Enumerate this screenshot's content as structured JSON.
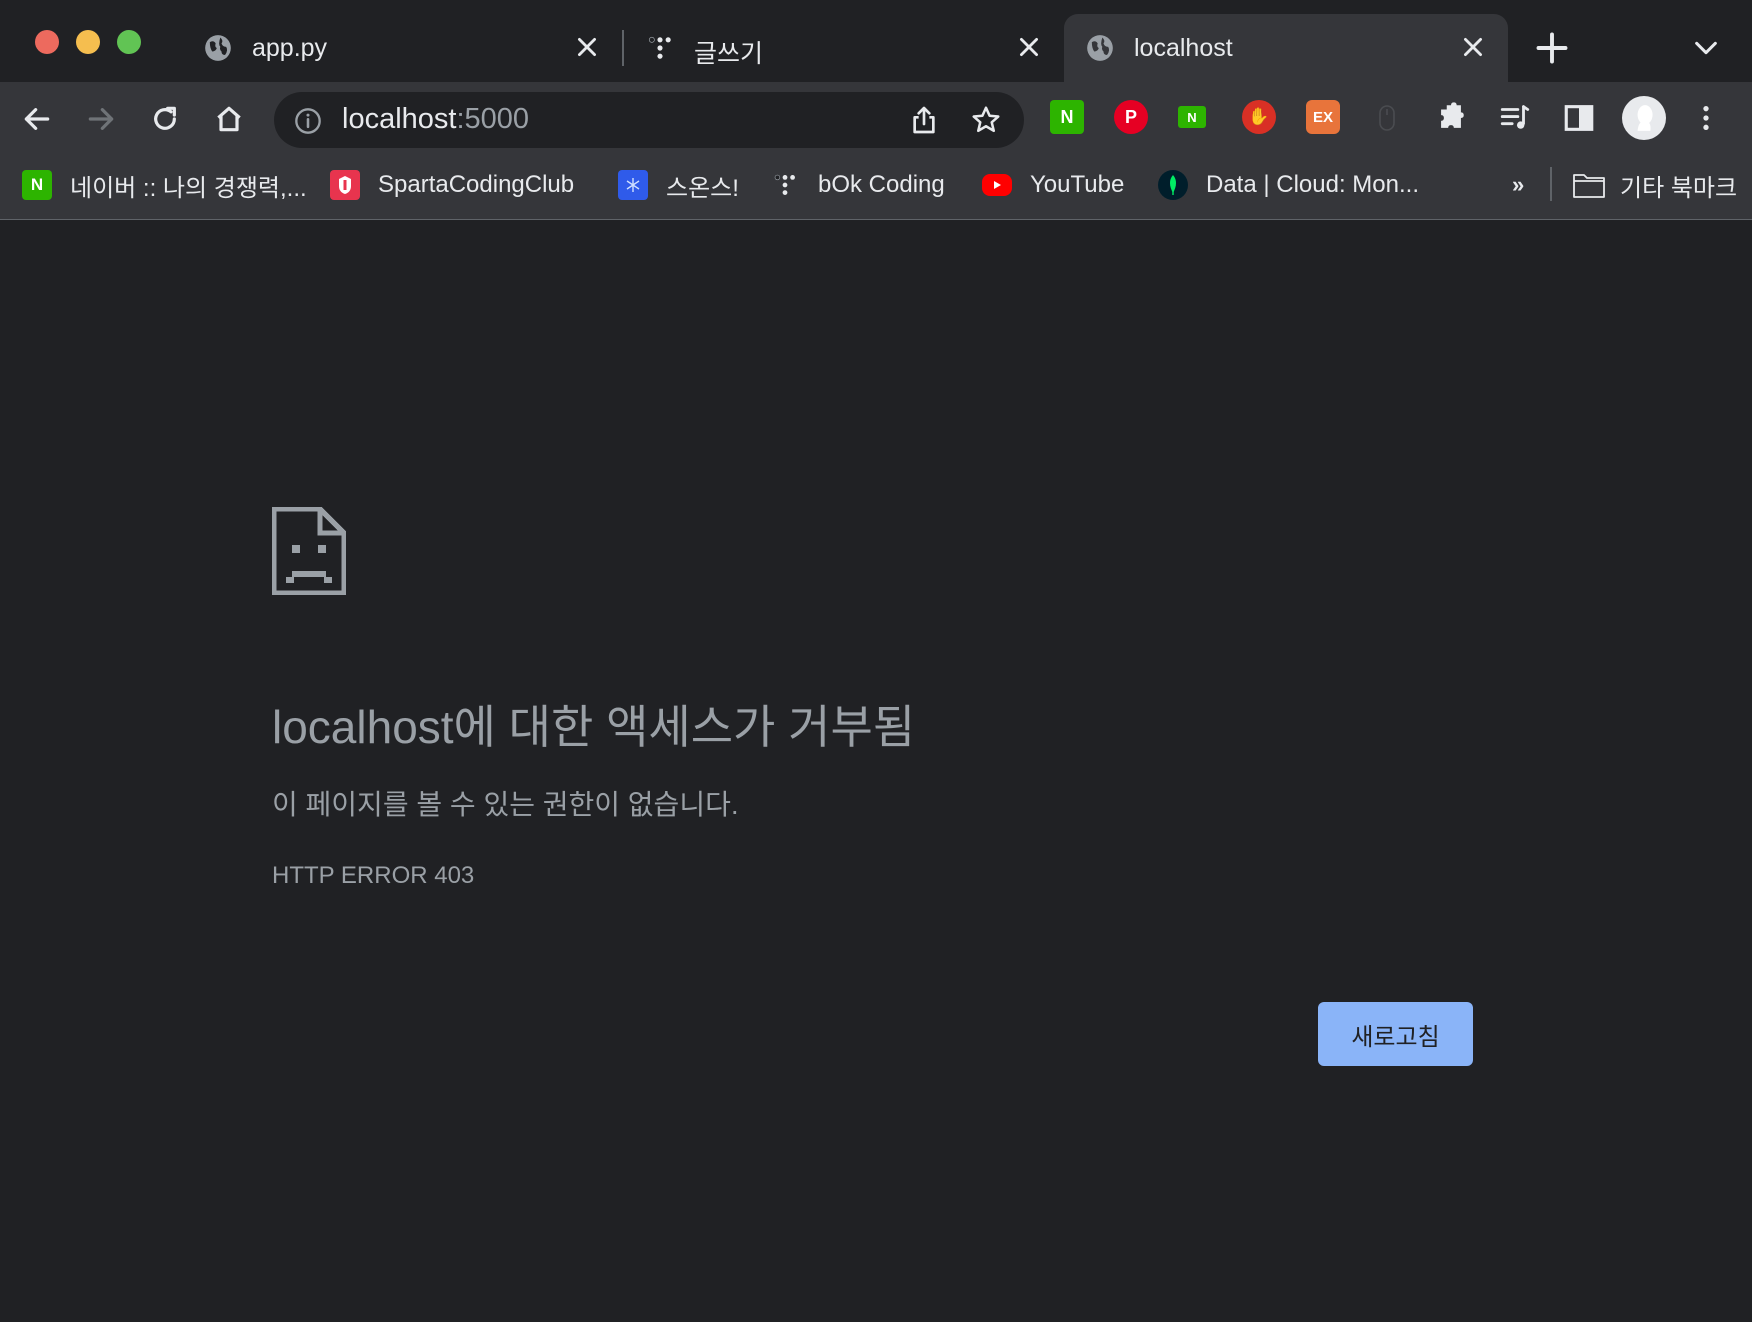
{
  "tabs": [
    {
      "title": "app.py",
      "icon": "globe-icon",
      "active": false
    },
    {
      "title": "글쓰기",
      "icon": "tistory-icon",
      "active": false
    },
    {
      "title": "localhost",
      "icon": "globe-icon",
      "active": true
    }
  ],
  "omnibox": {
    "host": "localhost",
    "port": ":5000"
  },
  "extensions": [
    {
      "name": "naver-extension",
      "label": "N",
      "color": "#2db400"
    },
    {
      "name": "pinterest-extension",
      "label": "P",
      "color": "#e60023"
    },
    {
      "name": "naver-dict-extension",
      "label": "N",
      "color": "#2db400"
    },
    {
      "name": "adblock-extension",
      "label": "✋",
      "color": "#d93025"
    },
    {
      "name": "ex-extension",
      "label": "EX",
      "color": "#e8743b"
    }
  ],
  "bookmarks": [
    {
      "label": "네이버 :: 나의 경쟁력,...",
      "icon": "naver-icon",
      "color": "#2db400"
    },
    {
      "label": "SpartaCodingClub",
      "icon": "sparta-icon",
      "color": "#e8344e"
    },
    {
      "label": "스온스!",
      "icon": "snowflake-icon",
      "color": "#2f5bea"
    },
    {
      "label": "bOk Coding",
      "icon": "tistory-icon",
      "color": "#202124"
    },
    {
      "label": "YouTube",
      "icon": "youtube-icon",
      "color": "#ff0000"
    },
    {
      "label": "Data | Cloud: Mon...",
      "icon": "mongodb-icon",
      "color": "#00684a"
    }
  ],
  "bookmarks_overflow": "»",
  "other_bookmarks": "기타 북마크",
  "error": {
    "title": "localhost에 대한 액세스가 거부됨",
    "description": "이 페이지를 볼 수 있는 권한이 없습니다.",
    "code": "HTTP ERROR 403",
    "reload_label": "새로고침"
  }
}
